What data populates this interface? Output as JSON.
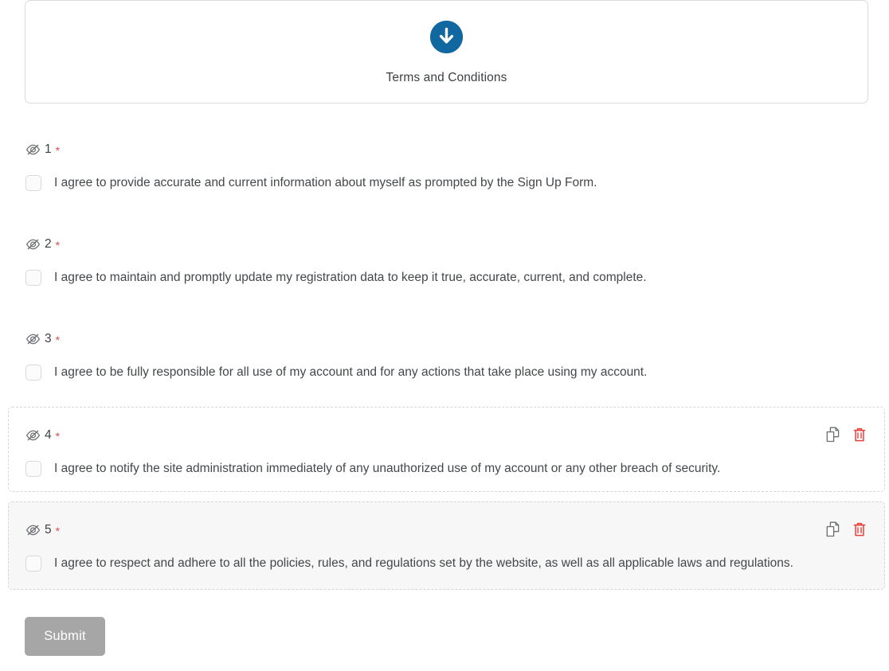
{
  "terms_card": {
    "icon": "download-circle-icon",
    "label": "Terms and Conditions",
    "accent_color": "#11679f"
  },
  "questions": [
    {
      "number": "1",
      "required_mark": "*",
      "visibility_icon": "eye-slash-icon",
      "checkbox_checked": false,
      "text": "I agree to provide accurate and current information about myself as prompted by the Sign Up Form.",
      "framed": false,
      "hovered": false,
      "actions": []
    },
    {
      "number": "2",
      "required_mark": "*",
      "visibility_icon": "eye-slash-icon",
      "checkbox_checked": false,
      "text": "I agree to maintain and promptly update my registration data to keep it true, accurate, current, and complete.",
      "framed": false,
      "hovered": false,
      "actions": []
    },
    {
      "number": "3",
      "required_mark": "*",
      "visibility_icon": "eye-slash-icon",
      "checkbox_checked": false,
      "text": "I agree to be fully responsible for all use of my account and for any actions that take place using my account.",
      "framed": false,
      "hovered": false,
      "actions": []
    },
    {
      "number": "4",
      "required_mark": "*",
      "visibility_icon": "eye-slash-icon",
      "checkbox_checked": false,
      "text": "I agree to notify the site administration immediately of any unauthorized use of my account or any other breach of security.",
      "framed": true,
      "hovered": false,
      "actions": [
        "copy-icon",
        "delete-icon"
      ]
    },
    {
      "number": "5",
      "required_mark": "*",
      "visibility_icon": "eye-slash-icon",
      "checkbox_checked": false,
      "text": "I agree to respect and adhere to all the policies, rules, and regulations set by the website, as well as all applicable laws and regulations.",
      "framed": true,
      "hovered": true,
      "actions": [
        "copy-icon",
        "delete-icon"
      ]
    }
  ],
  "submit": {
    "label": "Submit",
    "color": "#a6a6a6"
  },
  "colors": {
    "required_asterisk": "#e04b4b",
    "delete_icon": "#e8403a",
    "copy_icon": "#6b6f73",
    "text": "#444749"
  }
}
